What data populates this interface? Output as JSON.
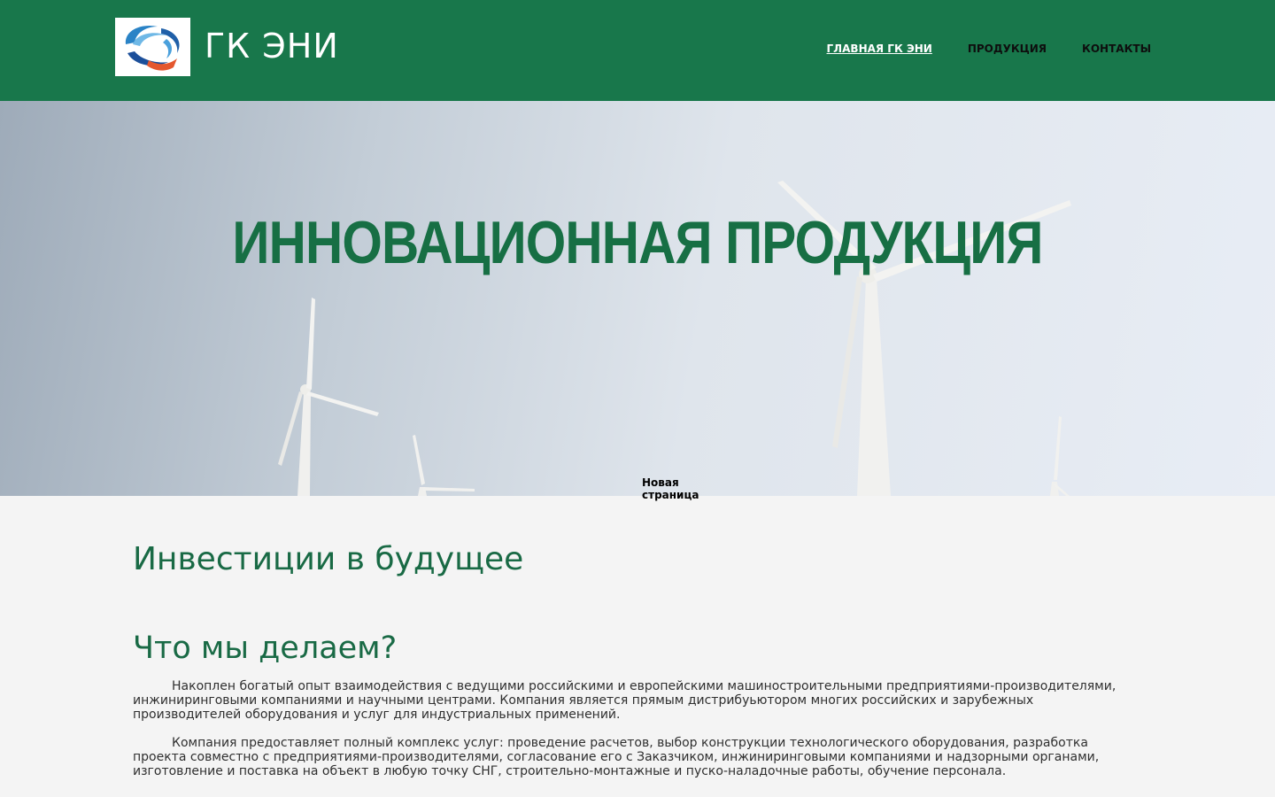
{
  "header": {
    "site_title": "ГК ЭНИ",
    "nav": [
      {
        "label": "ГЛАВНАЯ ГК ЭНИ",
        "active": true
      },
      {
        "label": "ПРОДУКЦИЯ",
        "active": false
      },
      {
        "label": "КОНТАКТЫ",
        "active": false
      }
    ]
  },
  "hero": {
    "title": "ИННОВАЦИОННАЯ ПРОДУКЦИЯ",
    "label": "Новая страница"
  },
  "main": {
    "heading_invest": "Инвестиции в будущее",
    "heading_what": "Что мы делаем?",
    "paragraphs": [
      "Накоплен богатый опыт взаимодействия с ведущими российскими и европейскими машиностроительными предприятиями-производителями, инжиниринговыми компаниями и научными центрами. Компания является прямым дистрибуьютором многих российских и зарубежных производителей оборудования и услуг для индустриальных применений.",
      "Компания предоставляет полный комплекс услуг: проведение расчетов, выбор конструкции технологического оборудования, разработка проекта совместно с предприятиями-производителями, согласование его с Заказчиком, инжиниринговыми компаниями и надзорными органами, изготовление и поставка на объект в любую точку СНГ, строительно-монтажные и пуско-наладочные работы, обучение персонала."
    ]
  },
  "colors": {
    "header_bg": "#18774b",
    "accent_green": "#196a45",
    "page_bg": "#f4f4f4"
  }
}
